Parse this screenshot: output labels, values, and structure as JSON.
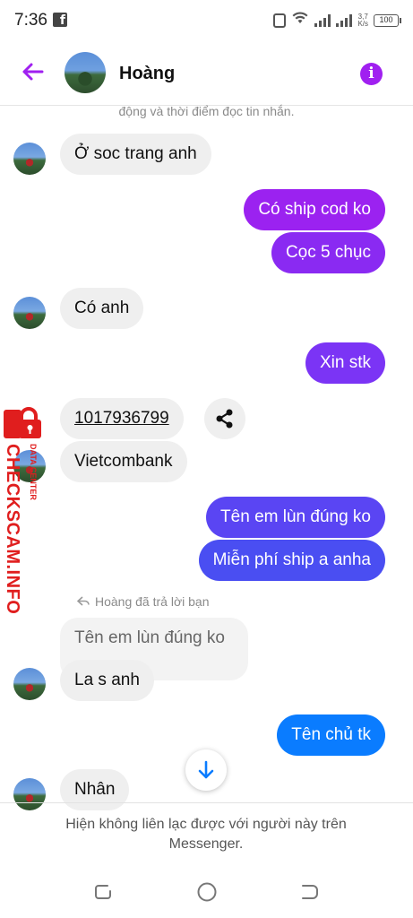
{
  "status_bar": {
    "time": "7:36",
    "net_speed_value": "3,7",
    "net_speed_unit": "K/s",
    "battery": "100"
  },
  "header": {
    "contact_name": "Hoàng",
    "accent_color": "#a020f0"
  },
  "conversation": {
    "top_notice": "động và thời điểm đọc tin nhắn.",
    "messages": [
      {
        "sender": "contact",
        "text": "Ở soc trang anh"
      },
      {
        "sender": "me",
        "text": "Có ship cod ko"
      },
      {
        "sender": "me",
        "text": "Cọc 5 chục"
      },
      {
        "sender": "contact",
        "text": "Có anh"
      },
      {
        "sender": "me",
        "text": "Xin stk"
      },
      {
        "sender": "contact",
        "text": "1017936799"
      },
      {
        "sender": "contact",
        "text": "Vietcombank"
      },
      {
        "sender": "me",
        "text": "Tên em lùn đúng ko"
      },
      {
        "sender": "me",
        "text": "Miễn phí ship a anha"
      },
      {
        "sender": "contact",
        "text": "La s anh"
      },
      {
        "sender": "me",
        "text": "Tên chủ tk"
      },
      {
        "sender": "contact",
        "text": "Nhân"
      }
    ],
    "reply": {
      "label": "Hoàng đã trả lời bạn",
      "quoted_text": "Tên em lùn đúng ko"
    }
  },
  "watermark": {
    "main_text": "CHECKSCAM.INFO",
    "sub_text": "DATA CENTER"
  },
  "footer": {
    "notice_line1": "Hiện không liên lạc được với người này trên",
    "notice_line2": "Messenger."
  },
  "colors": {
    "out_bubble_gradient": [
      "#a020f0",
      "#7b34f5",
      "#4e4af2",
      "#0a7cff"
    ],
    "in_bubble": "#efefef"
  }
}
